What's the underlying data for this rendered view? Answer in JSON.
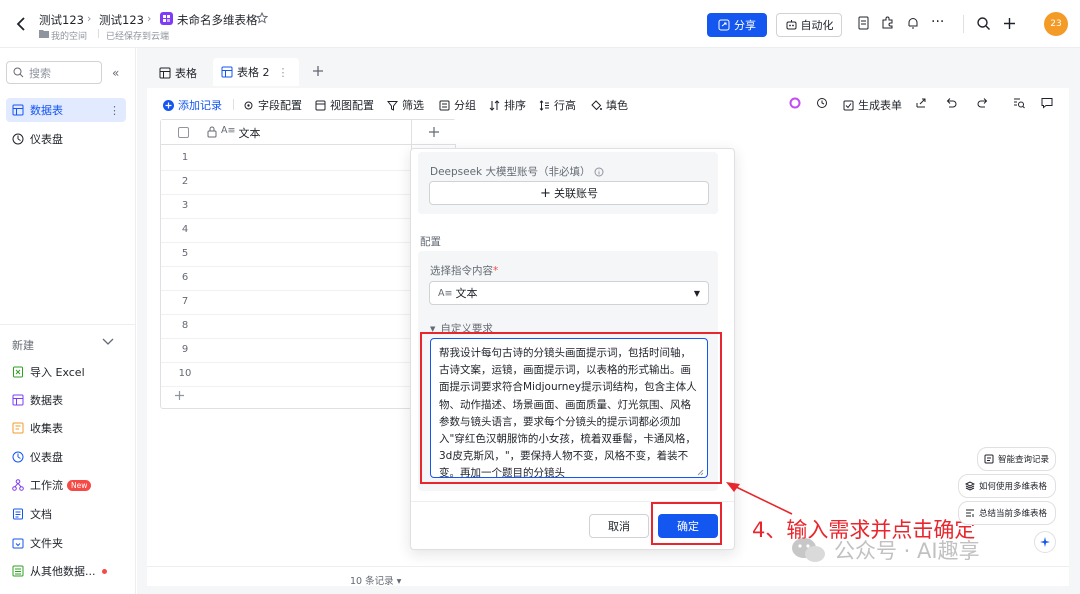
{
  "header": {
    "crumb1": "测试123",
    "crumb2": "测试123",
    "title": "未命名多维表格",
    "space": "我的空间",
    "saved": "已经保存到云端",
    "share": "分享",
    "automation": "自动化",
    "avatar": "23"
  },
  "sidebar": {
    "search_placeholder": "搜索",
    "items": [
      {
        "label": "数据表"
      },
      {
        "label": "仪表盘"
      }
    ],
    "new_label": "新建",
    "new_items": [
      {
        "label": "导入 Excel"
      },
      {
        "label": "数据表"
      },
      {
        "label": "收集表"
      },
      {
        "label": "仪表盘"
      },
      {
        "label": "工作流",
        "badge": "New"
      },
      {
        "label": "文档"
      },
      {
        "label": "文件夹"
      },
      {
        "label": "从其他数据..."
      }
    ]
  },
  "tabs": [
    {
      "label": "表格"
    },
    {
      "label": "表格 2"
    }
  ],
  "toolbar": {
    "add_record": "添加记录",
    "field_config": "字段配置",
    "view_config": "视图配置",
    "filter": "筛选",
    "group": "分组",
    "sort": "排序",
    "row_height": "行高",
    "fill_color": "填色",
    "gen_form": "生成表单"
  },
  "grid": {
    "column": "文本",
    "column_prefix": "A≡",
    "rows": [
      "1",
      "2",
      "3",
      "4",
      "5",
      "6",
      "7",
      "8",
      "9",
      "10"
    ],
    "footer": "10 条记录"
  },
  "panel": {
    "account_label": "Deepseek 大模型账号（非必填）",
    "link_account": "关联账号",
    "config_label": "配置",
    "select_label": "选择指令内容",
    "required_mark": "*",
    "select_value": "文本",
    "select_prefix": "A≡",
    "custom_label": "自定义要求",
    "textarea": "帮我设计每句古诗的分镜头画面提示词，包括时间轴，古诗文案，运镜，画面提示词，以表格的形式输出。画面提示词要求符合Midjourney提示词结构，包含主体人物、动作描述、场景画面、画面质量、灯光氛围、风格参数与镜头语言，要求每个分镜头的提示词都必须加入\"穿红色汉朝服饰的小女孩，梳着双垂髻，卡通风格，3d皮克斯风，\"，要保持人物不变，风格不变，着装不变。再加一个题目的分镜头",
    "cancel": "取消",
    "confirm": "确定"
  },
  "floating": {
    "smart_query": "智能查询记录",
    "how_to": "如何使用多维表格",
    "summary": "总结当前多维表格"
  },
  "annotation": "4、输入需求并点击确定",
  "watermark": "公众号 · AI趣享",
  "colors": {
    "accent": "#1456f0",
    "red": "#e8262d"
  }
}
